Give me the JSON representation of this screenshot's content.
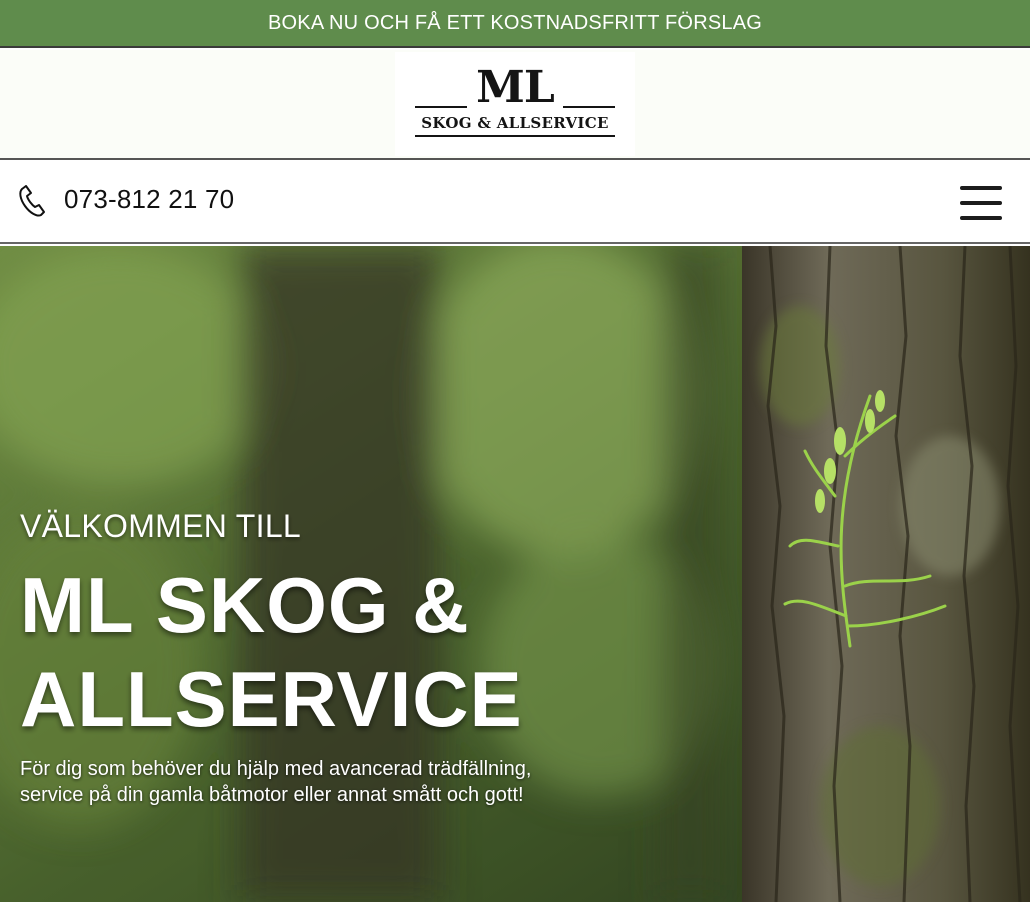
{
  "promo": {
    "text": "BOKA NU OCH FÅ ETT KOSTNADSFRITT FÖRSLAG",
    "color": "#5f8c4c"
  },
  "logo": {
    "main": "ML",
    "sub": "SKOG & ALLSERVICE"
  },
  "contact": {
    "phone": "073-812 21 70",
    "phone_icon": "phone-icon"
  },
  "nav": {
    "menu_icon": "hamburger-menu-icon"
  },
  "hero": {
    "welcome": "VÄLKOMMEN TILL",
    "title_line1": "ML SKOG &",
    "title_line2": "ALLSERVICE",
    "subtitle_line1": "För dig som behöver du hjälp med avancerad trädfällning,",
    "subtitle_line2": "service på din gamla båtmotor eller annat smått och gott!"
  }
}
